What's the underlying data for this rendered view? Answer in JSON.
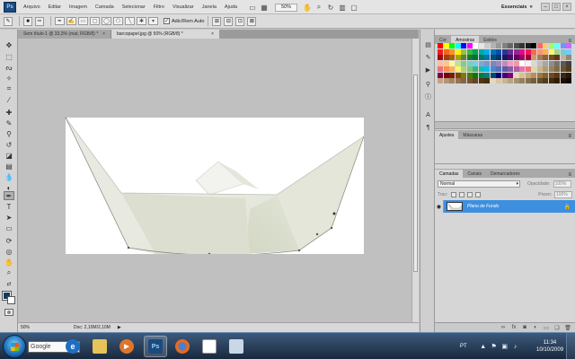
{
  "app": {
    "logo": "Ps",
    "menu": [
      "Arquivo",
      "Editar",
      "Imagem",
      "Camada",
      "Selecionar",
      "Filtro",
      "Visualizar",
      "Janela",
      "Ajuda"
    ],
    "zoom": "50%",
    "workspace": "Essenciais",
    "window_controls": [
      "–",
      "□",
      "×"
    ]
  },
  "options_bar": {
    "auto_add_label": "Adic/Rem Auto",
    "auto_add_checked": "✓"
  },
  "doc_tabs": [
    {
      "label": "Sem título-1 @ 33,3% (mat, RGB/8) *",
      "close": "×"
    },
    {
      "label": "barcopapel.jpg @ 50% (RGB/8) *",
      "close": "×"
    }
  ],
  "status_bar": {
    "zoom": "50%",
    "doc": "Doc: 2,10M/2,10M",
    "arrow": "▶"
  },
  "panels": {
    "color_tabs": [
      "Cor",
      "Amostras",
      "Estilos"
    ],
    "color_active": "Amostras",
    "adjust_tabs": [
      "Ajustes",
      "Máscaras"
    ],
    "adjust_active": "Ajustes",
    "layers_tabs": [
      "Camadas",
      "Canais",
      "Demarcadores"
    ],
    "layers_active": "Camadas",
    "blend_mode": "Normal",
    "opacity_label": "Opacidade:",
    "opacity_value": "100%",
    "lock_label": "Trav:",
    "fill_label": "Preen:",
    "fill_value": "100%",
    "layer_name": "Plano de Fundo",
    "panel_menu": "≡"
  },
  "swatch_colors": [
    [
      "#ff0000",
      "#ffff00",
      "#00ff00",
      "#00ffff",
      "#0000ff",
      "#ff00ff",
      "#ffffff",
      "#e6e6e6",
      "#cccccc",
      "#b3b3b3",
      "#999999",
      "#808080",
      "#666666",
      "#4d4d4d",
      "#333333",
      "#1a1a1a",
      "#000000",
      "#ff6666",
      "#ffcc66",
      "#99ff66",
      "#66ffff",
      "#6699ff",
      "#cc66ff"
    ],
    [
      "#ed1c24",
      "#f26522",
      "#f7941d",
      "#fff200",
      "#8dc63f",
      "#39b54a",
      "#00a651",
      "#00a99d",
      "#00aeef",
      "#0072bc",
      "#0054a6",
      "#2e3192",
      "#662d91",
      "#92278f",
      "#ec008c",
      "#ed145b",
      "#f26c4f",
      "#f69679",
      "#fbaf5d",
      "#fff568",
      "#a3d39c",
      "#7accc8",
      "#6dcff6"
    ],
    [
      "#9e0b0f",
      "#a0410d",
      "#a36209",
      "#aba000",
      "#598527",
      "#197b30",
      "#007236",
      "#00746b",
      "#0076a3",
      "#004a80",
      "#003471",
      "#1b1464",
      "#440e62",
      "#630460",
      "#9e005d",
      "#9e0039",
      "#c69c6d",
      "#a67c52",
      "#8c6239",
      "#754c24",
      "#603913",
      "#c7b299",
      "#998675"
    ],
    [
      "#fbbfa0",
      "#fdc689",
      "#fff799",
      "#c4df9b",
      "#82ca9c",
      "#7bcdc8",
      "#6ecff6",
      "#7da7d9",
      "#8393ca",
      "#8781bd",
      "#a186be",
      "#bd8cbf",
      "#f49ac1",
      "#f5989d",
      "#ffffff",
      "#f2f2f2",
      "#d9d9d9",
      "#bfbfbf",
      "#a6a6a6",
      "#8c8c8c",
      "#737373",
      "#595959",
      "#404040"
    ],
    [
      "#f26d7d",
      "#f68e56",
      "#fbaf5c",
      "#fff467",
      "#acd372",
      "#7cc576",
      "#3bb878",
      "#1abbb4",
      "#00bff3",
      "#438ccb",
      "#5574b9",
      "#605ca8",
      "#855fa8",
      "#a763a9",
      "#f06ea9",
      "#f26d7d",
      "#e2d5a5",
      "#c8b68b",
      "#b19c71",
      "#998259",
      "#826a42",
      "#6b532c",
      "#543c17"
    ],
    [
      "#7b0046",
      "#7d0000",
      "#7d1c00",
      "#7d4900",
      "#7d7d00",
      "#467d00",
      "#007d00",
      "#007d46",
      "#007d7d",
      "#00467d",
      "#00007d",
      "#46007d",
      "#7d007d",
      "#e8d8b8",
      "#d8c098",
      "#c8a878",
      "#b89058",
      "#a07840",
      "#886030",
      "#704820",
      "#583818",
      "#402810",
      "#281808"
    ],
    [
      "#c4a484",
      "#b39473",
      "#a38463",
      "#937453",
      "#836443",
      "#735433",
      "#634423",
      "#533413",
      "#433003",
      "#ead5b5",
      "#d9c4a4",
      "#c8b393",
      "#b7a282",
      "#a69171",
      "#958060",
      "#846f4f",
      "#735e3e",
      "#624d2d",
      "#513c1c",
      "#402b0b",
      "#301a00",
      "#201000",
      "#100800"
    ]
  ],
  "taskbar": {
    "search_placeholder": "Google",
    "tray_lang": "PT",
    "clock_time": "11:34",
    "clock_date": "10/10/2009"
  }
}
